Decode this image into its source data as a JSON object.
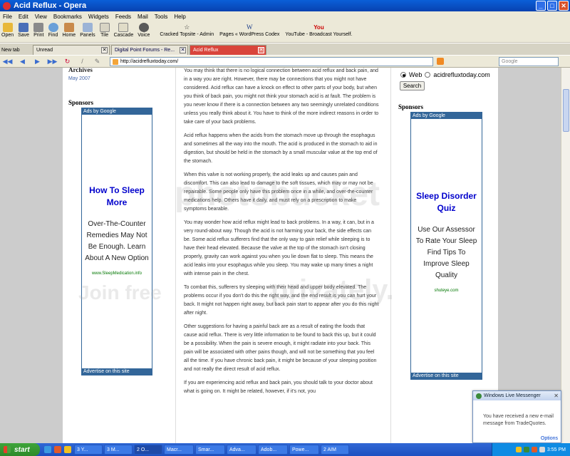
{
  "window": {
    "title": "Acid Reflux - Opera"
  },
  "menu": [
    "File",
    "Edit",
    "View",
    "Bookmarks",
    "Widgets",
    "Feeds",
    "Mail",
    "Tools",
    "Help"
  ],
  "toolbar": {
    "buttons": [
      {
        "label": "Open",
        "icon": "folder-icon"
      },
      {
        "label": "Save",
        "icon": "save-icon"
      },
      {
        "label": "Print",
        "icon": "print-icon"
      },
      {
        "label": "Find",
        "icon": "find-icon"
      },
      {
        "label": "Home",
        "icon": "home-icon"
      },
      {
        "label": "Panels",
        "icon": "panels-icon"
      },
      {
        "label": "Tile",
        "icon": "tile-icon"
      },
      {
        "label": "Cascade",
        "icon": "cascade-icon"
      },
      {
        "label": "Voice",
        "icon": "voice-icon"
      }
    ],
    "bookmarks": [
      {
        "label": "Cracked Topsite - Admin",
        "glyph": "☆"
      },
      {
        "label": "Pages « WordPress Codex",
        "glyph": "W"
      },
      {
        "label": "YouTube - Broadcast Yourself.",
        "glyph": "You"
      }
    ]
  },
  "tabs": {
    "newtab": "New tab",
    "items": [
      {
        "label": "Unread"
      },
      {
        "label": "Digital Point Forums - Re..."
      },
      {
        "label": "Acid Reflux"
      }
    ]
  },
  "address": {
    "url": "http://acidrefluxtoday.com/",
    "search_placeholder": "Google"
  },
  "left": {
    "archives_heading": "Archives",
    "archive_link": "May 2007",
    "sponsors_heading": "Sponsors",
    "ad": {
      "header": "Ads by Google",
      "title": "How To Sleep More",
      "body": "Over-The-Counter Remedies May Not Be Enough. Learn About A New Option",
      "url": "www.SleepMedication.info",
      "footer": "Advertise on this site"
    }
  },
  "right": {
    "radio_web": "Web",
    "radio_site": "acidrefluxtoday.com",
    "search_button": "Search",
    "sponsors_heading": "Sponsors",
    "ad": {
      "header": "Ads by Google",
      "title": "Sleep Disorder Quiz",
      "body": "Use Our Assessor To Rate Your Sleep Find Tips To Improve Sleep Quality",
      "url": "shuteye.com",
      "footer": "Advertise on this site"
    }
  },
  "article": [
    "You may think that there is no logical connection between acid reflux and back pain, and in a way you are right. However, there may be connections that you might not have considered. Acid reflux can have a knock on effect to other parts of your body, but when you think of back pain, you might not think your stomach acid is at fault. The problem is you never know if there is a connection between any two seemingly unrelated conditions unless you really think about it. You have to think of the more indirect reasons in order to take care of your back problems.",
    "Acid reflux happens when the acids from the stomach move up through the esophagus and sometimes all the way into the mouth. The acid is produced in the stomach to aid in digestion, but should be held in the stomach by a small muscular value at the top end of the stomach.",
    "When this valve is not working properly, the acid leaks up and causes pain and discomfort. This can also lead to damage to the soft tissues, which may or may not be repairable. Some people only have this problem once in a while, and over-the-counter medications help. Others have it daily, and must rely on a prescription to make symptoms bearable.",
    "You may wonder how acid reflux might lead to back problems. In a way, it can, but in a very round-about way. Though the acid is not harming your back, the side effects can be. Some acid reflux sufferers find that the only way to gain relief while sleeping is to have their head elevated. Because the valve at the top of the stomach isn't closing properly, gravity can work against you when you lie down flat to sleep. This means the acid leaks into your esophagus while you sleep. You may wake up many times a night with intense pain in the chest.",
    "To combat this, sufferers try sleeping with their head and upper body elevated. The problems occur if you don't do this the right way, and the end result is you can hurt your back. It might not happen right away, but back pain start to appear after you do this night after night.",
    "Other suggestions for having a painful back are as a result of eating the foods that cause acid reflux. There is very little information to be found to back this up, but it could be a possibility. When the pain is severe enough, it might radiate into your back. This pain will be associated with other pains though, and will not be something that you feel all the time. If you have chronic back pain, it might be because of your sleeping position and not really the direct result of acid reflux.",
    "If you are experiencing acid reflux and back pain, you should talk to your doctor about what is going on. It might be related, however, if it's not, you"
  ],
  "watermark": {
    "text1": "photobucket",
    "text2": "Join free",
    "text3": "privately."
  },
  "messenger": {
    "title": "Windows Live Messenger",
    "body": "You have received a new e-mail message from TradeQuotes.",
    "options": "Options"
  },
  "taskbar": {
    "start": "start",
    "items": [
      "3 Y...",
      "3 M...",
      "2 O...",
      "Macr...",
      "Smar...",
      "Adva...",
      "Adob...",
      "Powe...",
      "2 AIM"
    ],
    "time": "3:55 PM"
  },
  "colors": {
    "title_blue": "#0a5fd8",
    "ad_border": "#336699",
    "ad_title": "#0000cc",
    "tab_active": "#d9453b"
  }
}
